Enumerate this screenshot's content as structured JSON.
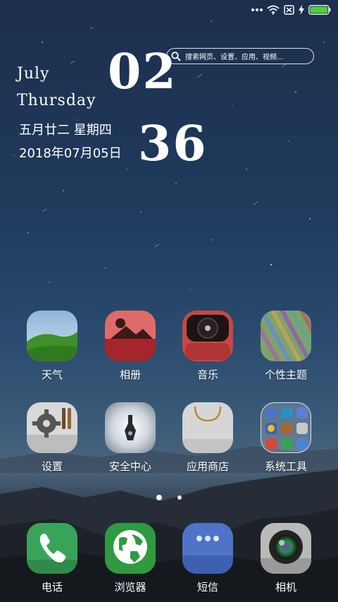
{
  "status_bar": {
    "icons": [
      "more-dots-icon",
      "wifi-icon",
      "no-sim-icon",
      "charging-icon",
      "battery-icon"
    ]
  },
  "clock_widget": {
    "month": "July",
    "weekday": "Thursday",
    "lunar_date": "五月廿二  星期四",
    "date": "2018年07月05日",
    "hour": "02",
    "minute": "36"
  },
  "search": {
    "placeholder": "搜索网页、设置、应用、视频..."
  },
  "apps_row1": [
    {
      "label": "天气",
      "icon": "weather-icon"
    },
    {
      "label": "相册",
      "icon": "gallery-icon"
    },
    {
      "label": "音乐",
      "icon": "music-icon"
    },
    {
      "label": "个性主题",
      "icon": "themes-icon"
    }
  ],
  "apps_row2": [
    {
      "label": "设置",
      "icon": "settings-icon"
    },
    {
      "label": "安全中心",
      "icon": "security-icon"
    },
    {
      "label": "应用商店",
      "icon": "app-store-icon"
    },
    {
      "label": "系统工具",
      "icon": "system-tools-folder-icon"
    }
  ],
  "page_indicator": {
    "pages": 2,
    "current": 1
  },
  "dock": [
    {
      "label": "电话",
      "icon": "phone-icon"
    },
    {
      "label": "浏览器",
      "icon": "browser-icon"
    },
    {
      "label": "短信",
      "icon": "messages-icon"
    },
    {
      "label": "相机",
      "icon": "camera-icon"
    }
  ],
  "colors": {
    "battery": "#4cd137",
    "phone": "#3aa35a",
    "browser": "#2f9a3f",
    "messages": "#4f73c9"
  }
}
